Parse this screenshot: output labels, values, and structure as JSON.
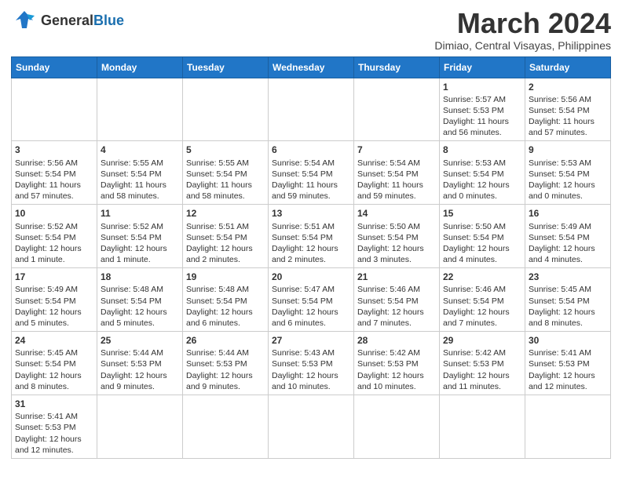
{
  "header": {
    "logo_general": "General",
    "logo_blue": "Blue",
    "month_year": "March 2024",
    "location": "Dimiao, Central Visayas, Philippines"
  },
  "weekdays": [
    "Sunday",
    "Monday",
    "Tuesday",
    "Wednesday",
    "Thursday",
    "Friday",
    "Saturday"
  ],
  "weeks": [
    [
      {
        "day": "",
        "info": ""
      },
      {
        "day": "",
        "info": ""
      },
      {
        "day": "",
        "info": ""
      },
      {
        "day": "",
        "info": ""
      },
      {
        "day": "",
        "info": ""
      },
      {
        "day": "1",
        "info": "Sunrise: 5:57 AM\nSunset: 5:53 PM\nDaylight: 11 hours and 56 minutes."
      },
      {
        "day": "2",
        "info": "Sunrise: 5:56 AM\nSunset: 5:54 PM\nDaylight: 11 hours and 57 minutes."
      }
    ],
    [
      {
        "day": "3",
        "info": "Sunrise: 5:56 AM\nSunset: 5:54 PM\nDaylight: 11 hours and 57 minutes."
      },
      {
        "day": "4",
        "info": "Sunrise: 5:55 AM\nSunset: 5:54 PM\nDaylight: 11 hours and 58 minutes."
      },
      {
        "day": "5",
        "info": "Sunrise: 5:55 AM\nSunset: 5:54 PM\nDaylight: 11 hours and 58 minutes."
      },
      {
        "day": "6",
        "info": "Sunrise: 5:54 AM\nSunset: 5:54 PM\nDaylight: 11 hours and 59 minutes."
      },
      {
        "day": "7",
        "info": "Sunrise: 5:54 AM\nSunset: 5:54 PM\nDaylight: 11 hours and 59 minutes."
      },
      {
        "day": "8",
        "info": "Sunrise: 5:53 AM\nSunset: 5:54 PM\nDaylight: 12 hours and 0 minutes."
      },
      {
        "day": "9",
        "info": "Sunrise: 5:53 AM\nSunset: 5:54 PM\nDaylight: 12 hours and 0 minutes."
      }
    ],
    [
      {
        "day": "10",
        "info": "Sunrise: 5:52 AM\nSunset: 5:54 PM\nDaylight: 12 hours and 1 minute."
      },
      {
        "day": "11",
        "info": "Sunrise: 5:52 AM\nSunset: 5:54 PM\nDaylight: 12 hours and 1 minute."
      },
      {
        "day": "12",
        "info": "Sunrise: 5:51 AM\nSunset: 5:54 PM\nDaylight: 12 hours and 2 minutes."
      },
      {
        "day": "13",
        "info": "Sunrise: 5:51 AM\nSunset: 5:54 PM\nDaylight: 12 hours and 2 minutes."
      },
      {
        "day": "14",
        "info": "Sunrise: 5:50 AM\nSunset: 5:54 PM\nDaylight: 12 hours and 3 minutes."
      },
      {
        "day": "15",
        "info": "Sunrise: 5:50 AM\nSunset: 5:54 PM\nDaylight: 12 hours and 4 minutes."
      },
      {
        "day": "16",
        "info": "Sunrise: 5:49 AM\nSunset: 5:54 PM\nDaylight: 12 hours and 4 minutes."
      }
    ],
    [
      {
        "day": "17",
        "info": "Sunrise: 5:49 AM\nSunset: 5:54 PM\nDaylight: 12 hours and 5 minutes."
      },
      {
        "day": "18",
        "info": "Sunrise: 5:48 AM\nSunset: 5:54 PM\nDaylight: 12 hours and 5 minutes."
      },
      {
        "day": "19",
        "info": "Sunrise: 5:48 AM\nSunset: 5:54 PM\nDaylight: 12 hours and 6 minutes."
      },
      {
        "day": "20",
        "info": "Sunrise: 5:47 AM\nSunset: 5:54 PM\nDaylight: 12 hours and 6 minutes."
      },
      {
        "day": "21",
        "info": "Sunrise: 5:46 AM\nSunset: 5:54 PM\nDaylight: 12 hours and 7 minutes."
      },
      {
        "day": "22",
        "info": "Sunrise: 5:46 AM\nSunset: 5:54 PM\nDaylight: 12 hours and 7 minutes."
      },
      {
        "day": "23",
        "info": "Sunrise: 5:45 AM\nSunset: 5:54 PM\nDaylight: 12 hours and 8 minutes."
      }
    ],
    [
      {
        "day": "24",
        "info": "Sunrise: 5:45 AM\nSunset: 5:54 PM\nDaylight: 12 hours and 8 minutes."
      },
      {
        "day": "25",
        "info": "Sunrise: 5:44 AM\nSunset: 5:53 PM\nDaylight: 12 hours and 9 minutes."
      },
      {
        "day": "26",
        "info": "Sunrise: 5:44 AM\nSunset: 5:53 PM\nDaylight: 12 hours and 9 minutes."
      },
      {
        "day": "27",
        "info": "Sunrise: 5:43 AM\nSunset: 5:53 PM\nDaylight: 12 hours and 10 minutes."
      },
      {
        "day": "28",
        "info": "Sunrise: 5:42 AM\nSunset: 5:53 PM\nDaylight: 12 hours and 10 minutes."
      },
      {
        "day": "29",
        "info": "Sunrise: 5:42 AM\nSunset: 5:53 PM\nDaylight: 12 hours and 11 minutes."
      },
      {
        "day": "30",
        "info": "Sunrise: 5:41 AM\nSunset: 5:53 PM\nDaylight: 12 hours and 12 minutes."
      }
    ],
    [
      {
        "day": "31",
        "info": "Sunrise: 5:41 AM\nSunset: 5:53 PM\nDaylight: 12 hours and 12 minutes."
      },
      {
        "day": "",
        "info": ""
      },
      {
        "day": "",
        "info": ""
      },
      {
        "day": "",
        "info": ""
      },
      {
        "day": "",
        "info": ""
      },
      {
        "day": "",
        "info": ""
      },
      {
        "day": "",
        "info": ""
      }
    ]
  ]
}
